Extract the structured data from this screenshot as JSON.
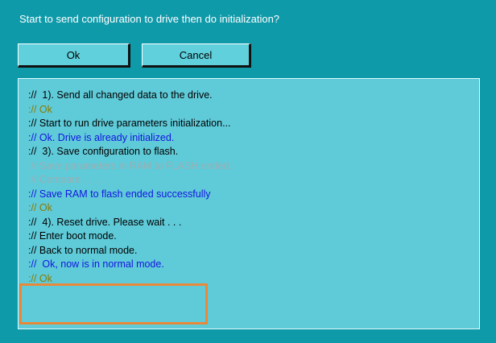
{
  "dialog": {
    "prompt": "Start to send configuration to drive then do initialization?",
    "ok_label": "Ok",
    "cancel_label": "Cancel"
  },
  "log": [
    {
      "text": "://  1). Send all changed data to the drive.",
      "color": "black"
    },
    {
      "text": ":// Ok",
      "color": "olive"
    },
    {
      "text": ":// Start to run drive parameters initialization...",
      "color": "black"
    },
    {
      "text": ":// Ok. Drive is already initialized.",
      "color": "blue"
    },
    {
      "text": "://  3). Save configuration to flash.",
      "color": "black"
    },
    {
      "text": ":// Save parameters in RAM to FLASH ended.",
      "color": "gray"
    },
    {
      "text": ":// Compare . . . . .",
      "color": "gray"
    },
    {
      "text": ":// Save RAM to flash ended successfully",
      "color": "blue"
    },
    {
      "text": ":// Ok",
      "color": "olive"
    },
    {
      "text": "://  4). Reset drive. Please wait . . .",
      "color": "black"
    },
    {
      "text": ":// Enter boot mode.",
      "color": "black"
    },
    {
      "text": ":// Back to normal mode.",
      "color": "black"
    },
    {
      "text": "://  Ok, now is in normal mode.",
      "color": "blue"
    },
    {
      "text": ":// Ok",
      "color": "olive"
    }
  ],
  "colors": {
    "background": "#0f9aaa",
    "log_background": "#5fcbd9",
    "highlight": "#e8893a"
  }
}
